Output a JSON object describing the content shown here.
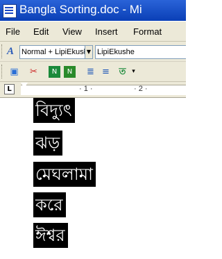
{
  "window": {
    "title": "Bangla Sorting.doc - Mi"
  },
  "menu": [
    "File",
    "Edit",
    "View",
    "Insert",
    "Format"
  ],
  "toolbar": {
    "style_value": "Normal + LipiEkusł",
    "font_value": "LipiEkushe"
  },
  "ruler": {
    "tab_icon": "L",
    "labels": [
      "· 1 ·",
      "· 2 ·"
    ]
  },
  "document": {
    "words": [
      "বিদ্যুৎ",
      "ঝড়",
      "মেঘলামা",
      "করে",
      "ঈশ্বর"
    ]
  },
  "colors": {
    "titlebar": "#0a3fb6",
    "chrome": "#ece9d8",
    "selection": "#000000"
  },
  "icons": [
    "app-word-icon",
    "style-icon",
    "toolbar-icons"
  ]
}
